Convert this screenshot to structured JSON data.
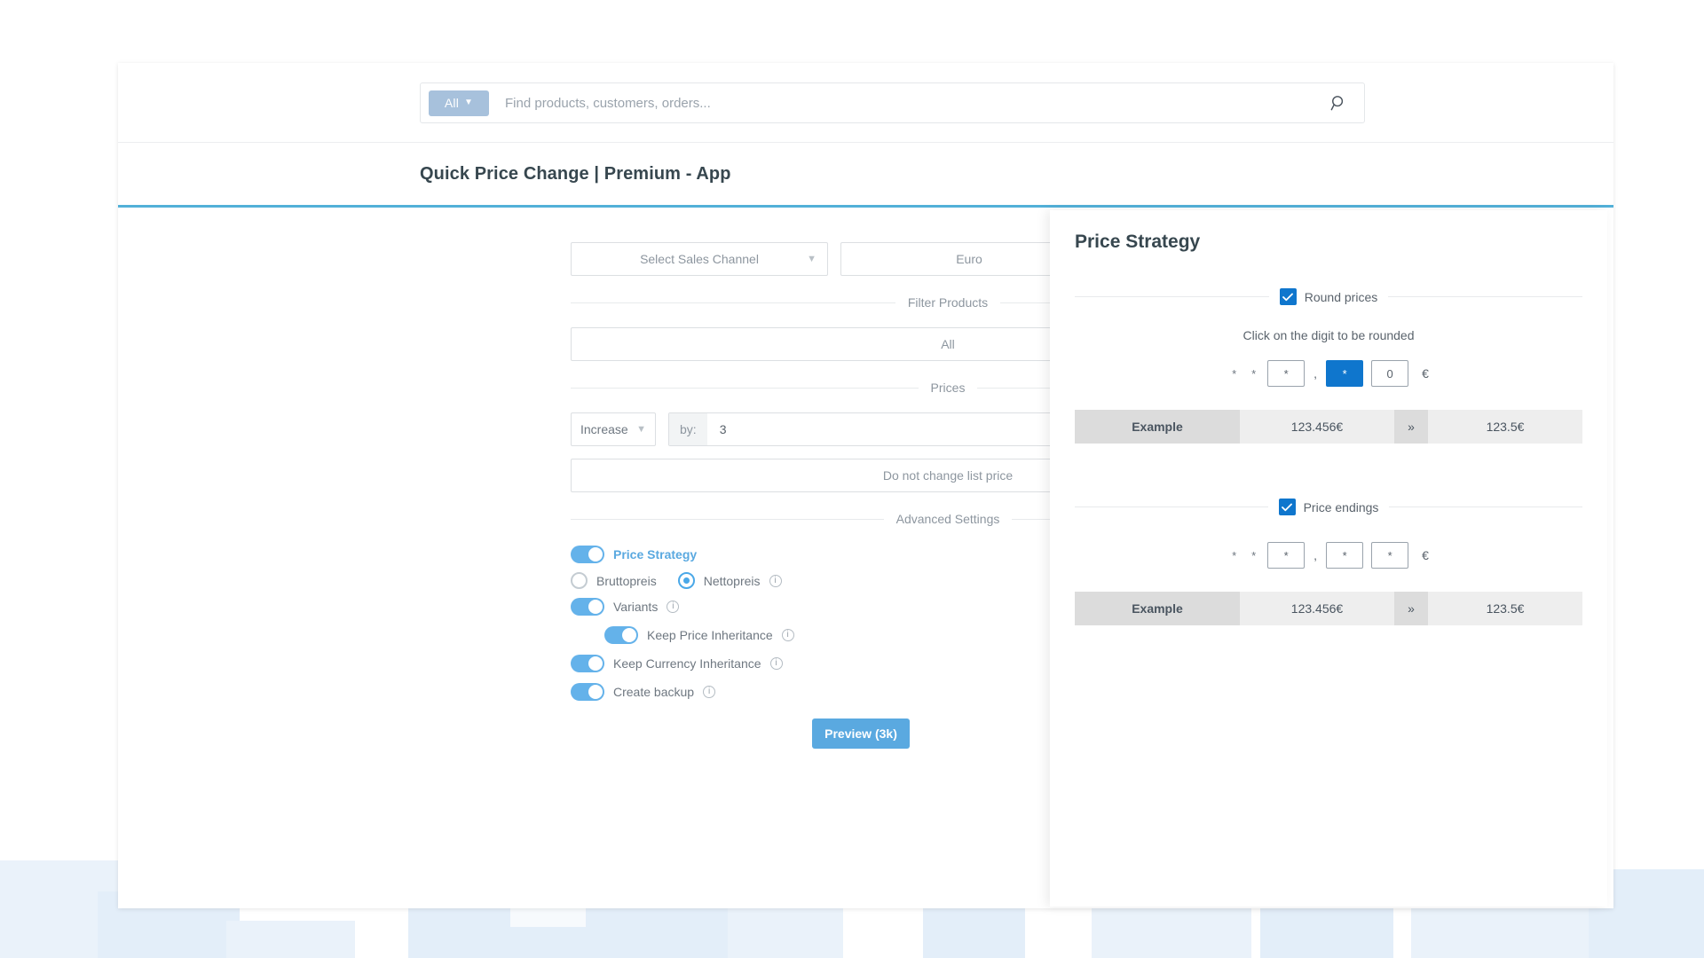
{
  "search": {
    "scope_label": "All",
    "scope_caret": "chevron-down",
    "placeholder": "Find products, customers, orders...",
    "value": "",
    "icon": "search-icon"
  },
  "header": {
    "title": "Quick Price Change | Premium - App",
    "accent_color": "#52b0d8"
  },
  "form": {
    "sales_channel": {
      "label": "Select Sales Channel",
      "chevron": "⌄"
    },
    "currency": {
      "label": "Euro"
    },
    "dividers": {
      "filter_products": "Filter Products",
      "prices": "Prices",
      "advanced_settings": "Advanced Settings"
    },
    "filter_all": "All",
    "price_mode": {
      "label": "Increase",
      "chevron": "⌄"
    },
    "by": {
      "label": "by:",
      "value": "3"
    },
    "list_price": "Do not change list price",
    "toggles": [
      {
        "label": "Price Strategy",
        "on": true,
        "accent": true,
        "info": false
      },
      {
        "label": "Variants",
        "on": true,
        "accent": false,
        "info": true
      },
      {
        "label": "Keep Price Inheritance",
        "on": true,
        "accent": false,
        "info": true
      },
      {
        "label": "Keep Currency Inheritance",
        "on": true,
        "accent": false,
        "info": true
      },
      {
        "label": "Create backup",
        "on": true,
        "accent": false,
        "info": true
      }
    ],
    "radios": [
      {
        "label": "Bruttopreis",
        "selected": false,
        "info": false
      },
      {
        "label": "Nettopreis",
        "selected": true,
        "info": true
      }
    ],
    "preview_button": "Preview (3k)"
  },
  "modal": {
    "title": "Price Strategy",
    "round": {
      "checkbox_label": "Round prices",
      "checked": true,
      "hint": "Click on the digit to be rounded",
      "prefix": [
        "*",
        "*"
      ],
      "boxes": [
        {
          "text": "*",
          "selected": false
        },
        {
          "text": "*",
          "selected": true
        },
        {
          "text": "0",
          "selected": false
        }
      ],
      "comma": ",",
      "currency_symbol": "€",
      "example": {
        "label": "Example",
        "from": "123.456€",
        "arrow": "»",
        "to": "123.5€"
      }
    },
    "endings": {
      "checkbox_label": "Price endings",
      "checked": true,
      "prefix": [
        "*",
        "*"
      ],
      "boxes": [
        {
          "text": "*",
          "selected": false
        },
        {
          "text": "*",
          "selected": false
        },
        {
          "text": "*",
          "selected": false
        }
      ],
      "comma": ",",
      "currency_symbol": "€",
      "example": {
        "label": "Example",
        "from": "123.456€",
        "arrow": "»",
        "to": "123.5€"
      }
    }
  },
  "colors": {
    "primary_blue": "#0f76cd",
    "accent_blue": "#52b0d8",
    "toggle_blue": "#64b2ea",
    "scope_blue": "#a7c1dc"
  }
}
